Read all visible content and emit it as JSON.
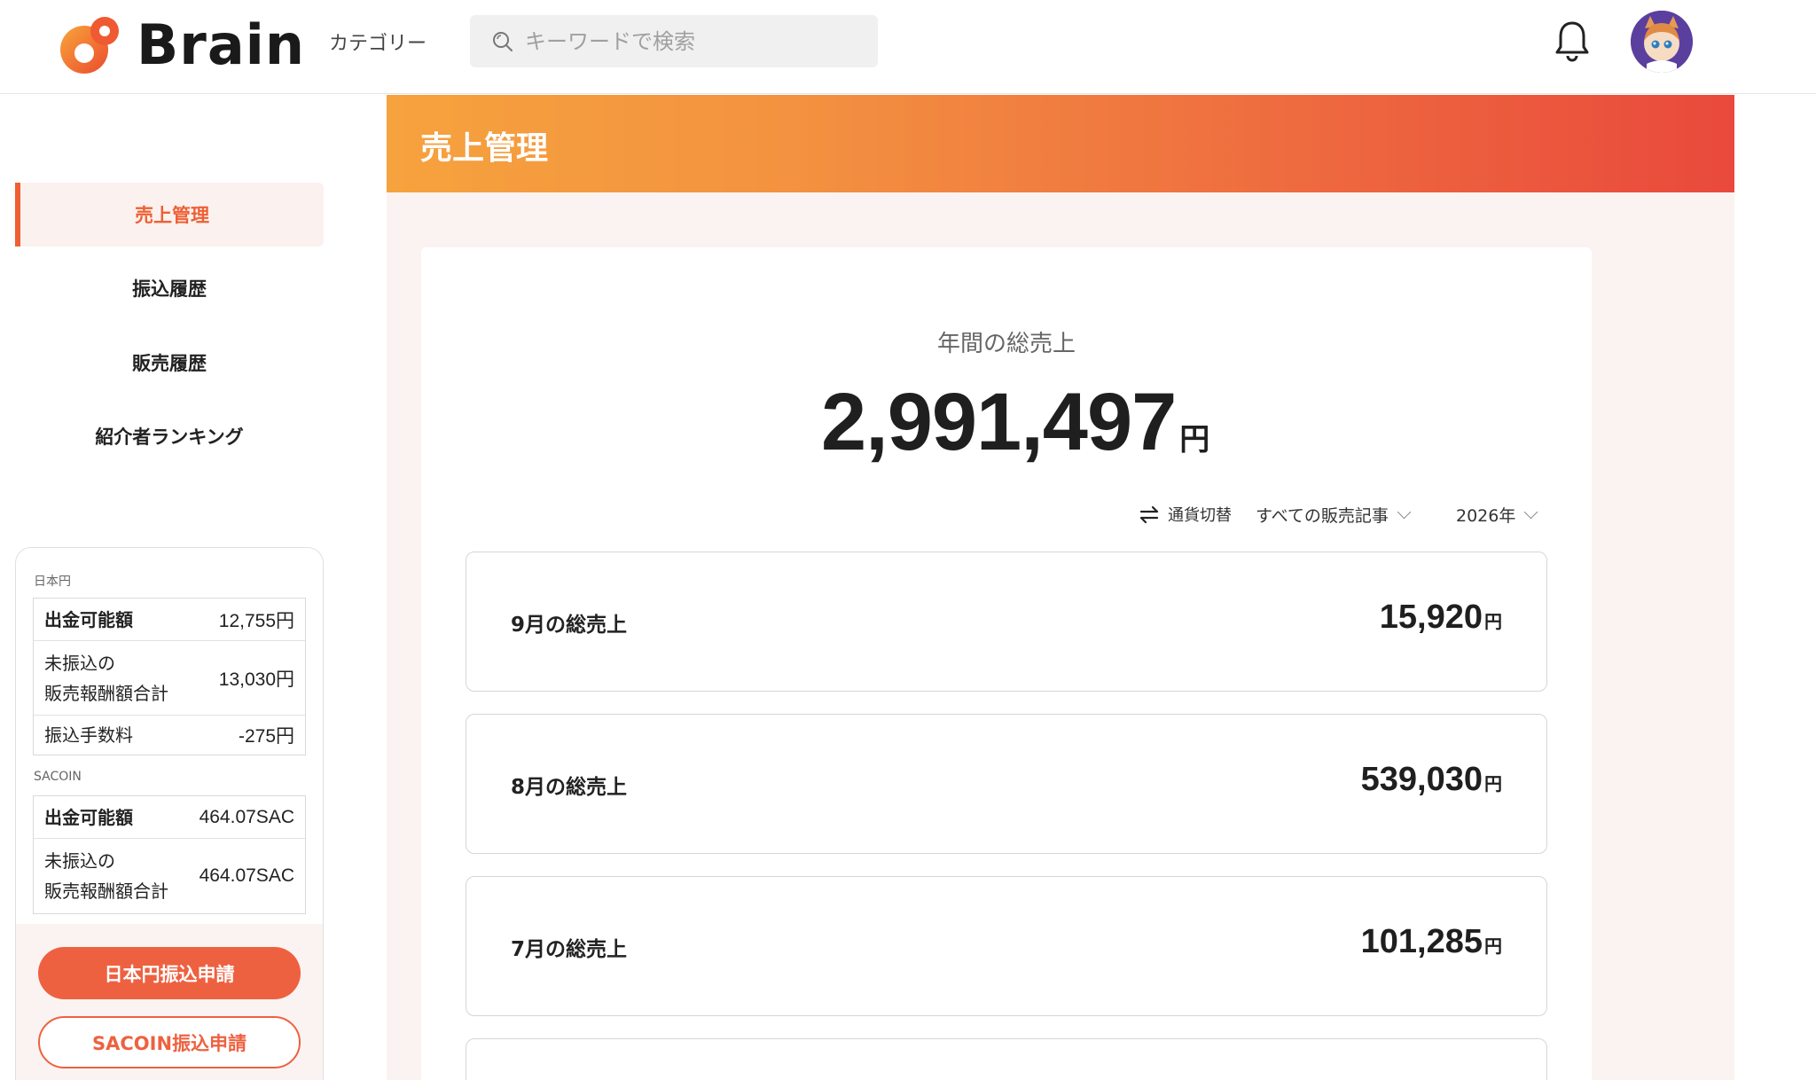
{
  "header": {
    "logo_text": "Brain",
    "category_label": "カテゴリー",
    "search_placeholder": "キーワードで検索"
  },
  "sidebar": {
    "items": [
      {
        "label": "売上管理",
        "active": true
      },
      {
        "label": "振込履歴",
        "active": false
      },
      {
        "label": "販売履歴",
        "active": false
      },
      {
        "label": "紹介者ランキング",
        "active": false
      }
    ],
    "yen_section": {
      "label": "日本円",
      "rows": [
        {
          "key": "出金可能額",
          "value": "12,755円"
        },
        {
          "key_line1": "未振込の",
          "key_line2": "販売報酬額合計",
          "value": "13,030円"
        },
        {
          "key": "振込手数料",
          "value": "-275円"
        }
      ]
    },
    "sacoin_section": {
      "label": "SACOIN",
      "rows": [
        {
          "key": "出金可能額",
          "value": "464.07SAC"
        },
        {
          "key_line1": "未振込の",
          "key_line2": "販売報酬額合計",
          "value": "464.07SAC"
        }
      ]
    },
    "yen_transfer_button": "日本円振込申請",
    "sacoin_transfer_button": "SACOIN振込申請"
  },
  "main": {
    "banner_title": "売上管理",
    "annual_label": "年間の総売上",
    "annual_value": "2,991,497",
    "currency_unit": "円",
    "controls": {
      "currency_switch": "通貨切替",
      "article_filter": "すべての販売記事",
      "year": "2026年"
    },
    "months": [
      {
        "label": "9月の総売上",
        "value": "15,920",
        "unit": "円"
      },
      {
        "label": "8月の総売上",
        "value": "539,030",
        "unit": "円"
      },
      {
        "label": "7月の総売上",
        "value": "101,285",
        "unit": "円"
      }
    ]
  },
  "colors": {
    "accent": "#ee6140",
    "banner_start": "#f6a23e",
    "banner_end": "#e9493c",
    "main_bg": "#fbf3f1"
  }
}
